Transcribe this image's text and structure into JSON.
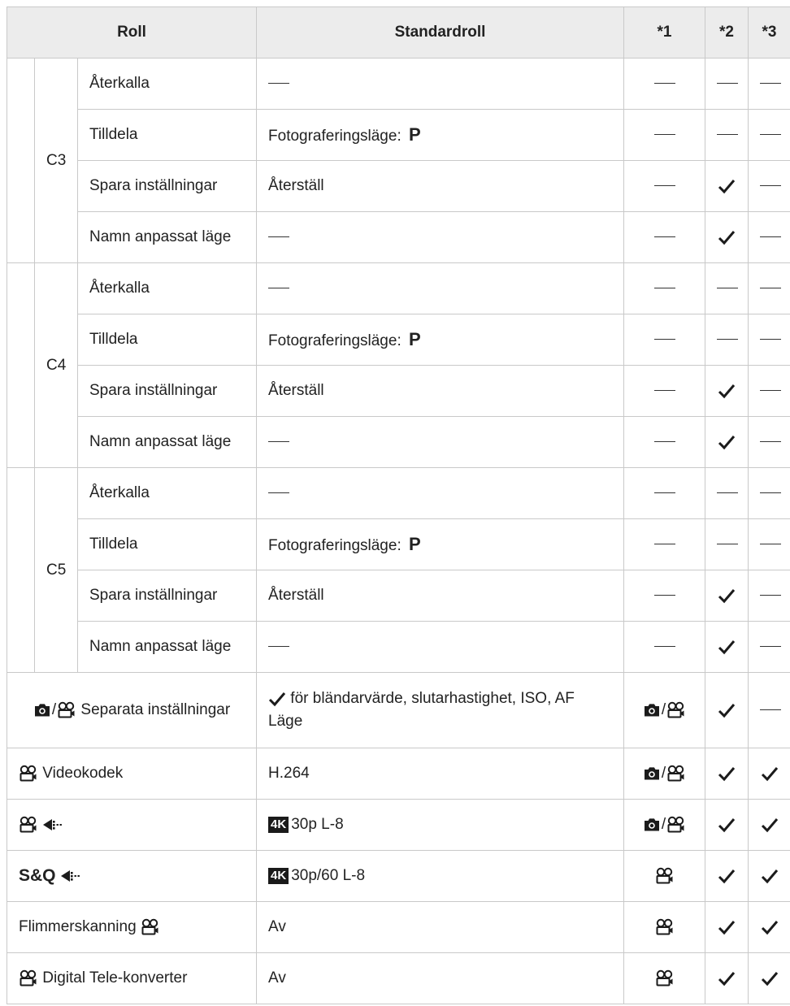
{
  "headers": {
    "roll": "Roll",
    "standard": "Standardroll",
    "n1": "*1",
    "n2": "*2",
    "n3": "*3"
  },
  "groups": [
    {
      "name": "C3",
      "rows": [
        {
          "label": "Återkalla",
          "value_dash": true,
          "n1": "dash",
          "n2": "dash",
          "n3": "dash"
        },
        {
          "label": "Tilldela",
          "value": "Fotograferingsläge: ",
          "value_bold": "P",
          "n1": "dash",
          "n2": "dash",
          "n3": "dash"
        },
        {
          "label": "Spara inställningar",
          "value": "Återställ",
          "n1": "dash",
          "n2": "check",
          "n3": "dash"
        },
        {
          "label": "Namn anpassat läge",
          "value_dash": true,
          "n1": "dash",
          "n2": "check",
          "n3": "dash"
        }
      ]
    },
    {
      "name": "C4",
      "rows": [
        {
          "label": "Återkalla",
          "value_dash": true,
          "n1": "dash",
          "n2": "dash",
          "n3": "dash"
        },
        {
          "label": "Tilldela",
          "value": "Fotograferingsläge: ",
          "value_bold": "P",
          "n1": "dash",
          "n2": "dash",
          "n3": "dash"
        },
        {
          "label": "Spara inställningar",
          "value": "Återställ",
          "n1": "dash",
          "n2": "check",
          "n3": "dash"
        },
        {
          "label": "Namn anpassat läge",
          "value_dash": true,
          "n1": "dash",
          "n2": "check",
          "n3": "dash"
        }
      ]
    },
    {
      "name": "C5",
      "rows": [
        {
          "label": "Återkalla",
          "value_dash": true,
          "n1": "dash",
          "n2": "dash",
          "n3": "dash"
        },
        {
          "label": "Tilldela",
          "value": "Fotograferingsläge: ",
          "value_bold": "P",
          "n1": "dash",
          "n2": "dash",
          "n3": "dash"
        },
        {
          "label": "Spara inställningar",
          "value": "Återställ",
          "n1": "dash",
          "n2": "check",
          "n3": "dash"
        },
        {
          "label": "Namn anpassat läge",
          "value_dash": true,
          "n1": "dash",
          "n2": "check",
          "n3": "dash"
        }
      ]
    }
  ],
  "main_rows": [
    {
      "label": "Separata inställningar",
      "icons": [
        "camera-icon",
        "video-icon"
      ],
      "value_check": true,
      "value": "för bländarvärde, slutarhastighet, ISO, AF Läge",
      "n1": "camera-video",
      "n2": "check",
      "n3": "dash"
    },
    {
      "label": "Videokodek",
      "icons": [
        "video-icon"
      ],
      "value": "H.264",
      "n1": "camera-video",
      "n2": "check",
      "n3": "check"
    },
    {
      "label": "",
      "icons": [
        "video-icon",
        "quality-icon"
      ],
      "badge": "4K",
      "value": "30p L-8",
      "n1": "camera-video",
      "n2": "check",
      "n3": "check"
    },
    {
      "label": "S&Q",
      "icons": [
        "quality-icon"
      ],
      "badge": "4K",
      "value": "30p/60 L-8",
      "n1": "video",
      "n2": "check",
      "n3": "check"
    },
    {
      "label": "Flimmerskanning",
      "icons_after": [
        "video-icon"
      ],
      "value": "Av",
      "n1": "video",
      "n2": "check",
      "n3": "check"
    },
    {
      "label": "Digital Tele-konverter",
      "icons": [
        "video-icon"
      ],
      "value": "Av",
      "n1": "video",
      "n2": "check",
      "n3": "check"
    }
  ],
  "slash": "/"
}
